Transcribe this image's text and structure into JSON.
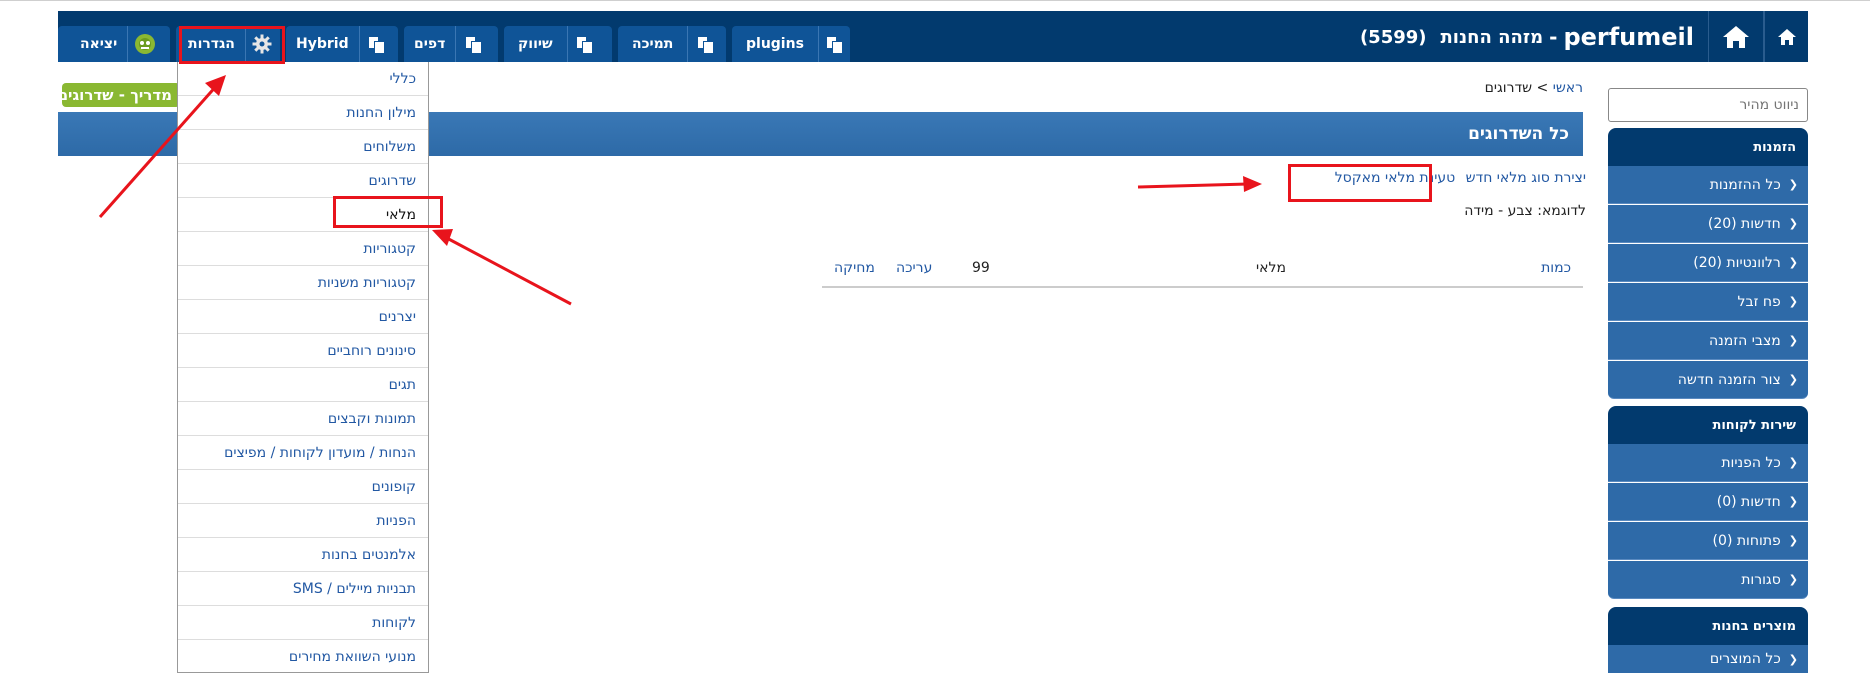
{
  "header": {
    "site_name": "perfumeil",
    "separator": "-",
    "store_id_label": "מזהה החנות",
    "store_id": "(5599)",
    "tabs": [
      {
        "label": "יציאה",
        "icon": "avatar-icon"
      },
      {
        "label": "הגדרות",
        "icon": "gear-icon"
      },
      {
        "label": "Hybrid",
        "icon": "copy-icon"
      },
      {
        "label": "דפים",
        "icon": "copy-icon"
      },
      {
        "label": "שיווק",
        "icon": "copy-icon"
      },
      {
        "label": "תמיכה",
        "icon": "copy-icon"
      },
      {
        "label": "plugins",
        "icon": "copy-icon"
      }
    ]
  },
  "settings_menu": {
    "items": [
      "כללי",
      "מילון החנות",
      "משלוחים",
      "שדרוגים",
      "מלאי",
      "קטגוריות",
      "קטגוריות משניות",
      "יצרנים",
      "סינונים רוחביים",
      "תגים",
      "תמונות וקבצים",
      "הנחות / מועדון לקוחות / מפיצים",
      "קופונים",
      "הפניות",
      "אלמנטים בחנות",
      "תבניות מיילים / SMS",
      "לקוחות",
      "מנועי השוואת מחירים"
    ],
    "highlighted": "מלאי"
  },
  "sidebar": {
    "quick_nav_placeholder": "ניווט מהיר",
    "sections": [
      {
        "title": "הזמנות",
        "items": [
          "כל ההזמנות",
          "חדשות (20)",
          "רלוונטיות (20)",
          "פח זבל",
          "מצבי הזמנה",
          "צור הזמנה חדשה"
        ]
      },
      {
        "title": "שירות לקוחות",
        "items": [
          "כל הפניות",
          "חדשות (0)",
          "פתוחות (0)",
          "סגורות"
        ]
      },
      {
        "title": "מוצרים בחנות",
        "items": [
          "כל המוצרים"
        ]
      }
    ]
  },
  "main": {
    "guide_badge": "מדריך - שדרוגים",
    "breadcrumb": {
      "home": "ראשי",
      "separator": ">",
      "current": "שדרוגים"
    },
    "title": "כל השדרוגים",
    "actions": {
      "create": "יצירת סוג מלאי חדש",
      "import": "טעינת מלאי מאקסל"
    },
    "example": "לדוגמא: צבע - מידה",
    "table_row": {
      "qty_label": "כמות",
      "name": "מלאי",
      "value": "99",
      "edit": "עריכה",
      "delete": "מחיקה"
    }
  },
  "colors": {
    "header_bg": "#023a6e",
    "tab_bg": "#0f5497",
    "sidebar_item_bg": "#2e6aa8",
    "title_bar": "#3a78b6",
    "link": "#2258a3",
    "badge": "#8ab832",
    "annotation_red": "#e8141c"
  }
}
